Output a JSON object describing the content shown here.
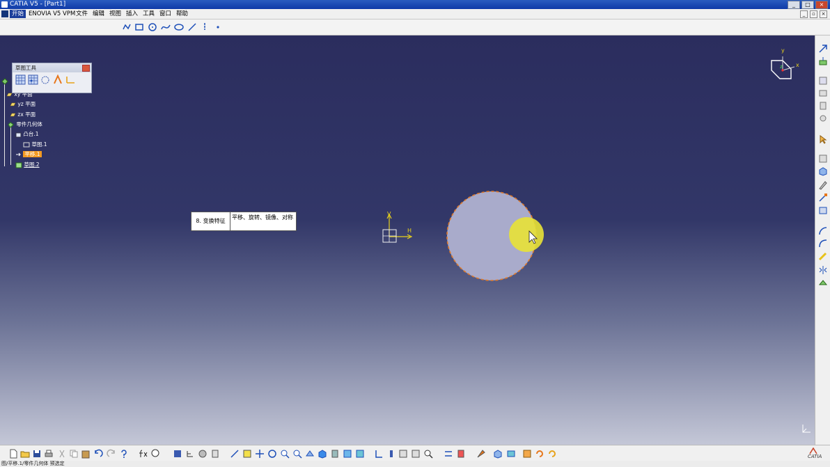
{
  "window": {
    "title": "CATIA V5 - [Part1]",
    "minimize_label": "_",
    "maximize_label": "□",
    "close_label": "×"
  },
  "menubar": {
    "items": [
      "开始",
      "ENOVIA V5 VPM",
      "文件",
      "编辑",
      "视图",
      "插入",
      "工具",
      "窗口",
      "帮助"
    ],
    "mdi_buttons": [
      "_",
      "▫",
      "×"
    ]
  },
  "sketch_tools": {
    "title": "草图工具"
  },
  "tree": {
    "nodes": [
      "xy 平面",
      "yz 平面",
      "zx 平面",
      "零件几何体",
      "凸台.1",
      "草图.1",
      "平移.1",
      "草图.2"
    ]
  },
  "note": {
    "left": "8. 变换特征",
    "right": "平移、旋转、镜像、对称"
  },
  "axis_labels": {
    "v": "V",
    "h": "H"
  },
  "compass": {
    "x": "x",
    "y": "y",
    "z": "z"
  },
  "bottom_logo": "CATIA",
  "status_text": "图/平移.1/零件几何体 预选定",
  "colors": {
    "titlebar": "#1540b0",
    "canvas_top": "#2b2d5e",
    "canvas_bottom": "#c4c7d7",
    "circle_fill": "#a9abcb",
    "circle_outline": "#e07a2a",
    "highlight": "#e8e236",
    "axis_yellow": "#e8d21c",
    "tree_highlight": "#f39a22"
  }
}
